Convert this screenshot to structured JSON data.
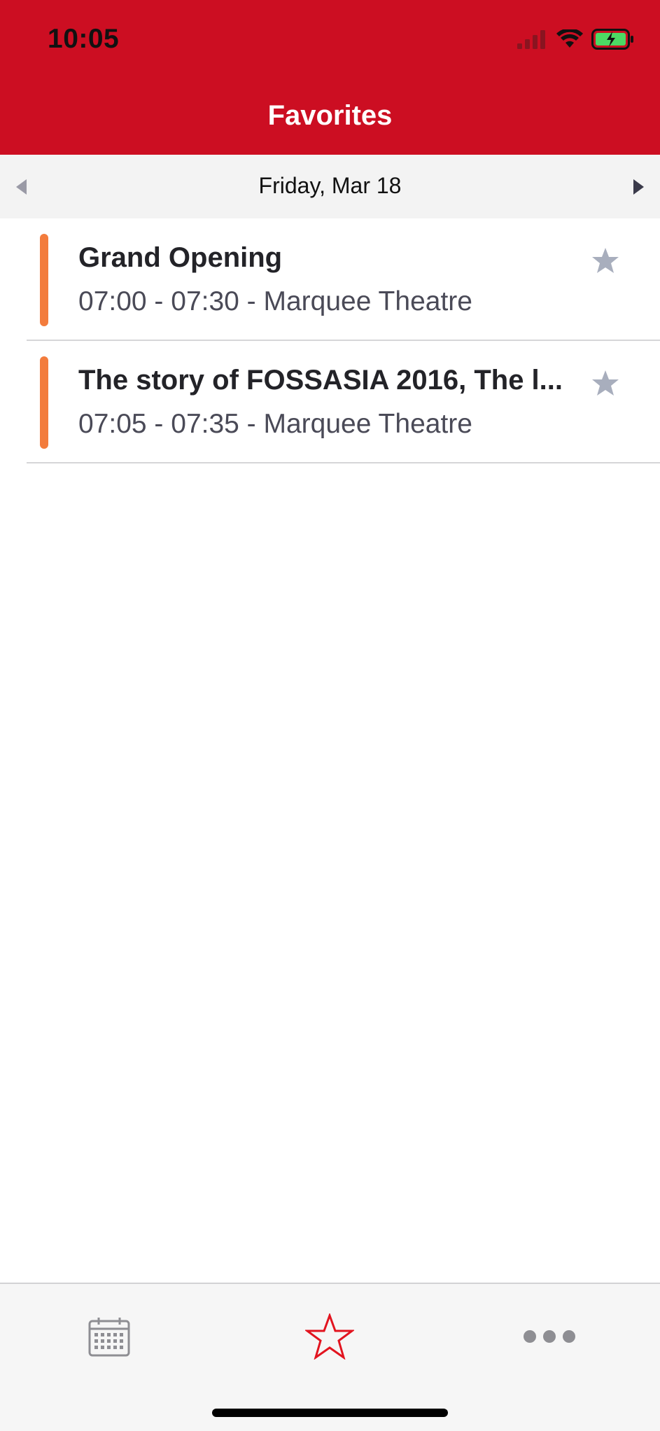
{
  "status_bar": {
    "time": "10:05"
  },
  "header": {
    "title": "Favorites"
  },
  "date_nav": {
    "label": "Friday, Mar 18"
  },
  "sessions": [
    {
      "title": "Grand Opening",
      "time_location": "07:00 - 07:30 - Marquee Theatre",
      "track_color": "#F37C3D"
    },
    {
      "title": "The story of FOSSASIA 2016, The l...",
      "time_location": "07:05 - 07:35 - Marquee Theatre",
      "track_color": "#F37C3D"
    }
  ],
  "tabs": [
    {
      "icon": "calendar-icon"
    },
    {
      "icon": "star-outline-icon",
      "selected": true
    },
    {
      "icon": "more-dots-icon"
    }
  ],
  "colors": {
    "brand": "#CC0E22",
    "track": "#F37C3D",
    "star_inactive": "#A8AEBD",
    "tab_selected": "#E2141F",
    "tab_inactive": "#8E8E93"
  }
}
